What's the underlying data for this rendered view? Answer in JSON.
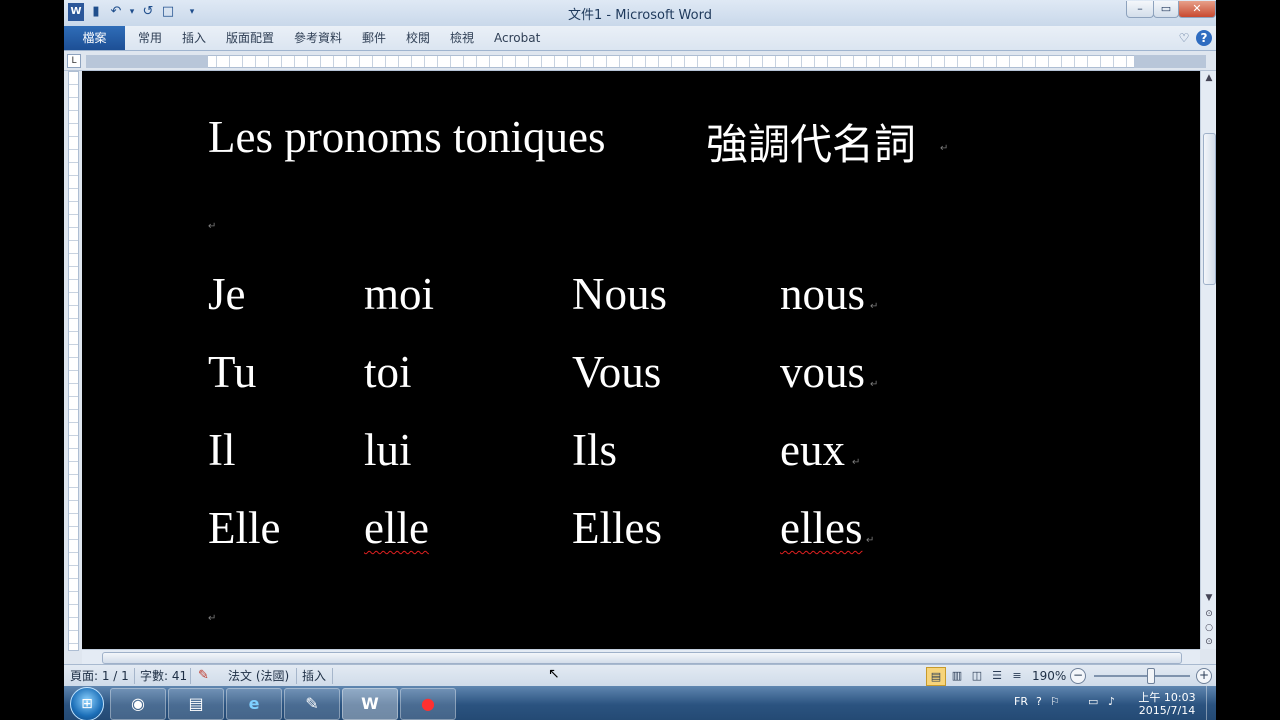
{
  "window": {
    "title": "文件1 - Microsoft Word"
  },
  "qat": {
    "word_icon": "W",
    "save_icon": "▮",
    "undo_icon": "↶",
    "redo_icon": "↺",
    "new_icon": "□",
    "dropdown_icon": "▾"
  },
  "window_controls": {
    "minimize": "–",
    "maximize": "▭",
    "close": "✕"
  },
  "ribbon": {
    "file_tab": "檔案",
    "tabs": [
      "常用",
      "插入",
      "版面配置",
      "參考資料",
      "郵件",
      "校閱",
      "檢視",
      "Acrobat"
    ],
    "minimize_icon": "♡",
    "help_icon": "?"
  },
  "ruler": {
    "corner": "L"
  },
  "document": {
    "title": "Les pronoms toniques",
    "title_zh": "強調代名詞",
    "rows": [
      {
        "subject": "Je",
        "tonic": "moi",
        "subject_pl": "Nous",
        "tonic_pl": "nous"
      },
      {
        "subject": "Tu",
        "tonic": "toi",
        "subject_pl": "Vous",
        "tonic_pl": "vous"
      },
      {
        "subject": "Il",
        "tonic": "lui",
        "subject_pl": "Ils",
        "tonic_pl": "eux"
      },
      {
        "subject": "Elle",
        "tonic": "elle",
        "subject_pl": "Elles",
        "tonic_pl": "elles"
      }
    ],
    "para_mark": "↵"
  },
  "scrollbar": {
    "up_icon": "▲",
    "down_icon": "▼",
    "prev_icon": "⊙",
    "select_icon": "○",
    "next_icon": "⊙"
  },
  "status": {
    "page": "頁面: 1 / 1",
    "words": "字數: 41",
    "language": "法文 (法國)",
    "mode": "插入",
    "zoom": "190%",
    "zoom_minus": "−",
    "zoom_plus": "+"
  },
  "taskbar": {
    "apps": [
      {
        "name": "chrome",
        "glyph": "◉"
      },
      {
        "name": "explorer",
        "glyph": "▤"
      },
      {
        "name": "ie",
        "glyph": "e"
      },
      {
        "name": "mic",
        "glyph": "✎"
      },
      {
        "name": "word",
        "glyph": "W"
      },
      {
        "name": "recorder",
        "glyph": "●"
      }
    ],
    "language": "FR",
    "time": "上午 10:03",
    "date": "2015/7/14"
  }
}
